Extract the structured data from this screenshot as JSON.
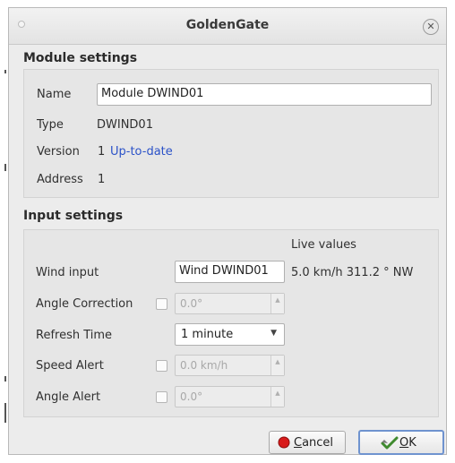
{
  "window": {
    "title": "GoldenGate",
    "close_glyph": "✕"
  },
  "module_settings": {
    "heading": "Module settings",
    "name_label": "Name",
    "name_value": "Module DWIND01",
    "type_label": "Type",
    "type_value": "DWIND01",
    "version_label": "Version",
    "version_value": "1",
    "version_status": "Up-to-date",
    "address_label": "Address",
    "address_value": "1"
  },
  "input_settings": {
    "heading": "Input settings",
    "live_values_header": "Live values",
    "wind_input_label": "Wind input",
    "wind_input_value": "Wind DWIND01",
    "wind_live_value": "5.0 km/h 311.2 ° NW",
    "angle_correction_label": "Angle Correction",
    "angle_correction_checked": false,
    "angle_correction_value": "0.0°",
    "refresh_time_label": "Refresh Time",
    "refresh_time_value": "1 minute",
    "speed_alert_label": "Speed Alert",
    "speed_alert_checked": false,
    "speed_alert_value": "0.0 km/h",
    "angle_alert_label": "Angle Alert",
    "angle_alert_checked": false,
    "angle_alert_value": "0.0°"
  },
  "buttons": {
    "cancel_label_accel": "C",
    "cancel_label_rest": "ancel",
    "ok_label_accel": "O",
    "ok_label_rest": "K"
  },
  "colors": {
    "link": "#2b52c8",
    "cancel_icon": "#d81b1b",
    "ok_icon": "#3f8a2e"
  },
  "icons": {
    "cancel": "red-circle-icon",
    "ok": "checkmark-arrow-icon"
  }
}
